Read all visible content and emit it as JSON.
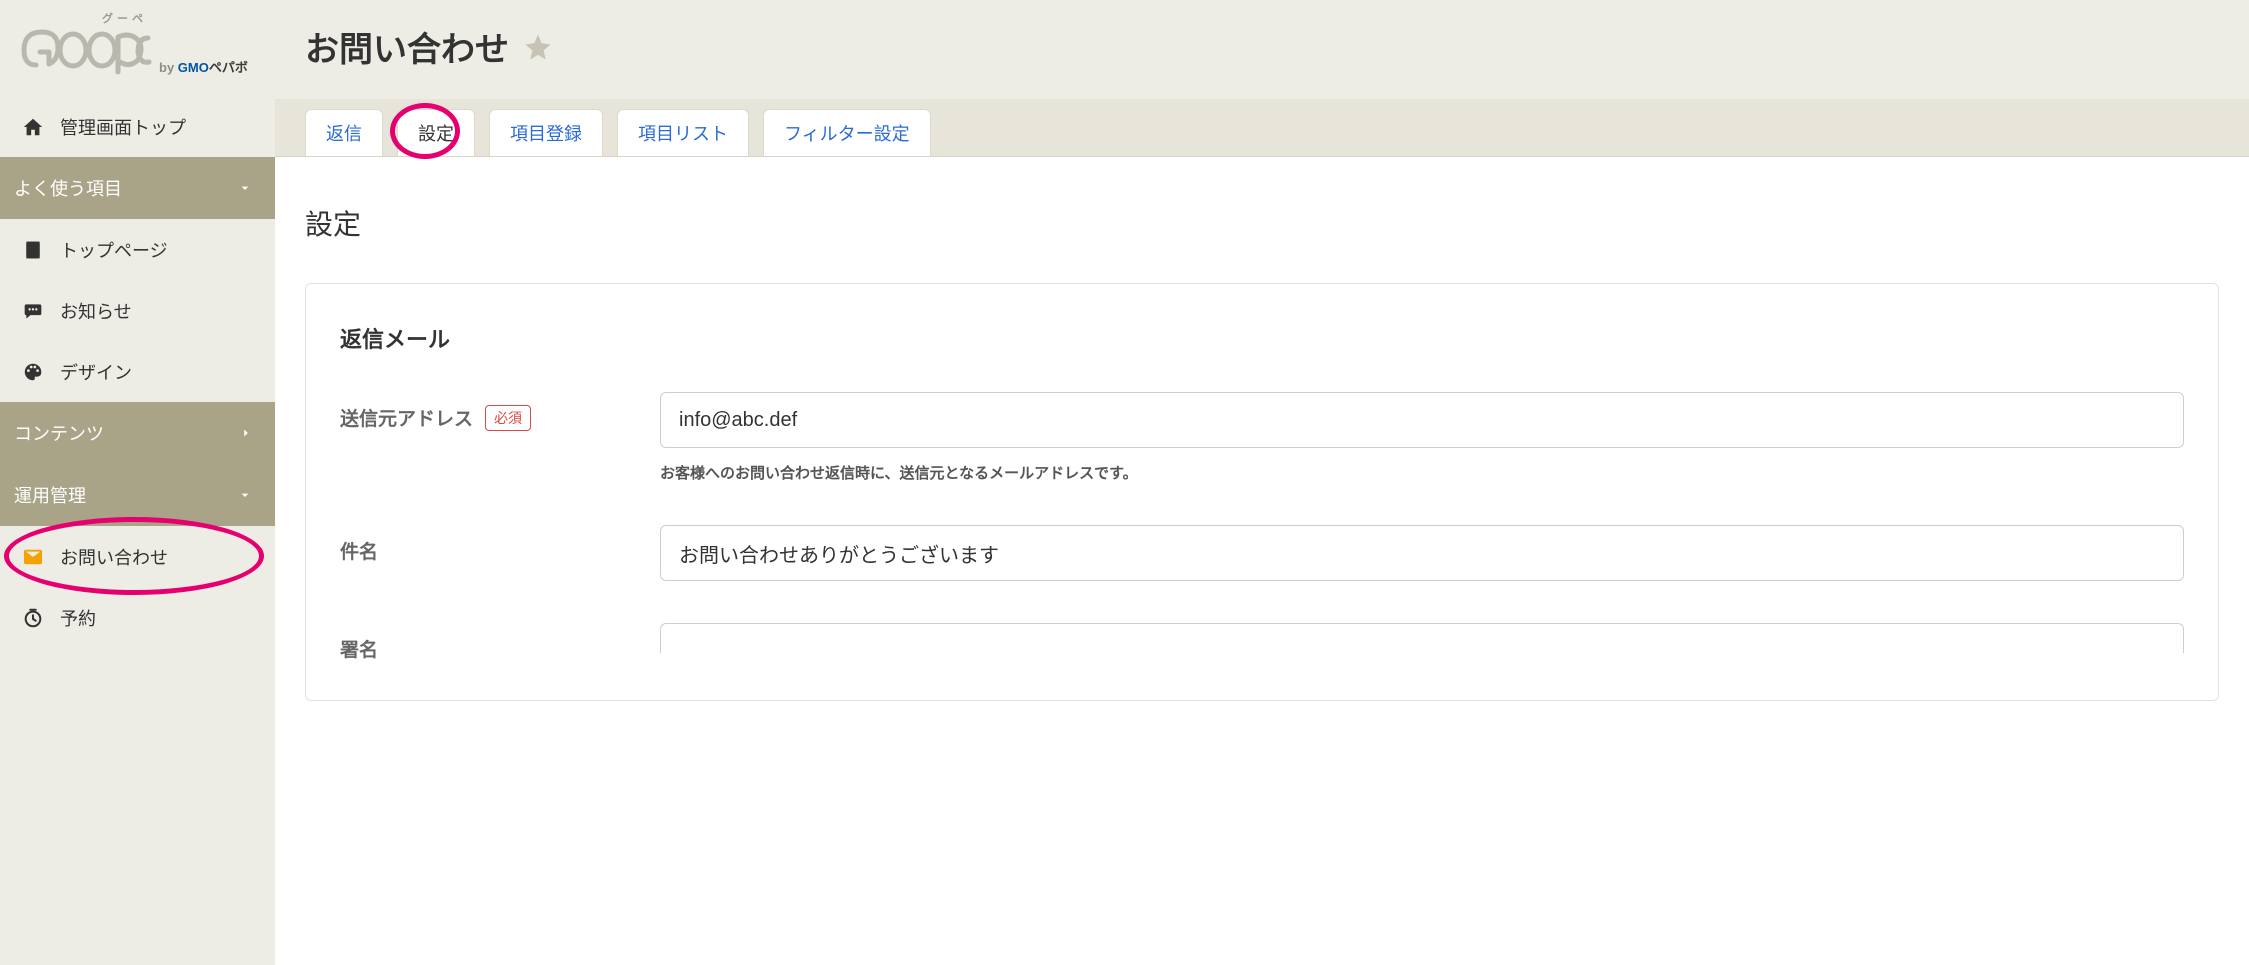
{
  "brand": {
    "furigana": "グーペ",
    "by_prefix": "by",
    "gmo": "GMO",
    "pepabo": "ペパボ"
  },
  "sidebar": {
    "top": "管理画面トップ",
    "section_frequent": "よく使う項目",
    "item_toppage": "トップページ",
    "item_news": "お知らせ",
    "item_design": "デザイン",
    "section_contents": "コンテンツ",
    "section_ops": "運用管理",
    "item_inquiry": "お問い合わせ",
    "item_reserve": "予約"
  },
  "header": {
    "title": "お問い合わせ"
  },
  "tabs": {
    "reply": "返信",
    "settings": "設定",
    "register": "項目登録",
    "list": "項目リスト",
    "filter": "フィルター設定"
  },
  "section": {
    "title": "設定",
    "panel_title": "返信メール",
    "sender_label": "送信元アドレス",
    "required_badge": "必須",
    "sender_value": "info@abc.def",
    "sender_hint": "お客様へのお問い合わせ返信時に、送信元となるメールアドレスです。",
    "subject_label": "件名",
    "subject_value": "お問い合わせありがとうございます",
    "signature_label": "署名"
  }
}
